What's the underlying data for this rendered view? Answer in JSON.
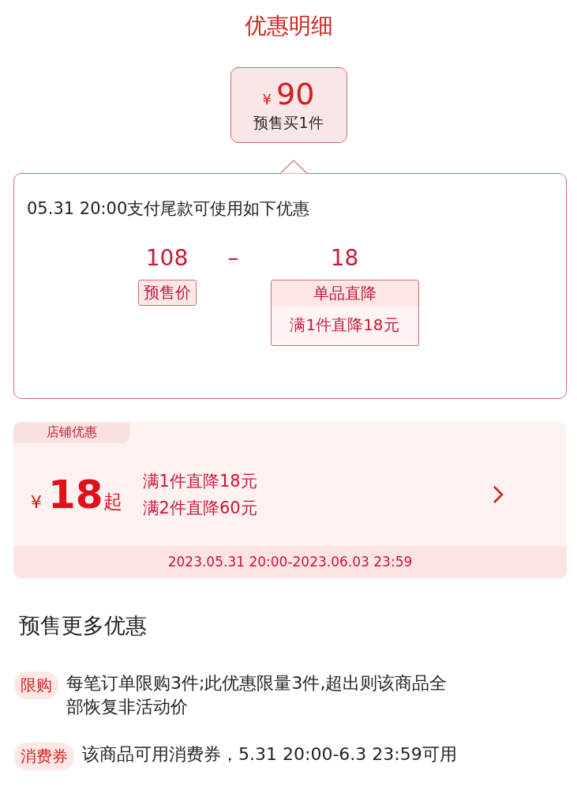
{
  "title": "优惠明细",
  "price_box": {
    "currency": "¥",
    "amount": "90",
    "caption": "预售买1件"
  },
  "detail": {
    "heading": "05.31 20:00支付尾款可使用如下优惠",
    "presale": {
      "value": "108",
      "label": "预售价"
    },
    "operator": "–",
    "discount": {
      "value": "18",
      "label": "单品直降",
      "description": "满1件直降18元"
    }
  },
  "store_offer": {
    "tag": "店铺优惠",
    "currency": "¥",
    "amount": "18",
    "suffix": "起",
    "rules": [
      "满1件直降18元",
      "满2件直降60元"
    ],
    "period": "2023.05.31 20:00-2023.06.03 23:59"
  },
  "more": {
    "heading": "预售更多优惠",
    "items": [
      {
        "tag": "限购",
        "text": "每笔订单限购3件;此优惠限量3件,超出则该商品全部恢复非活动价"
      },
      {
        "tag": "消费券",
        "text": "该商品可用消费券，5.31 20:00-6.3 23:59可用"
      }
    ]
  }
}
